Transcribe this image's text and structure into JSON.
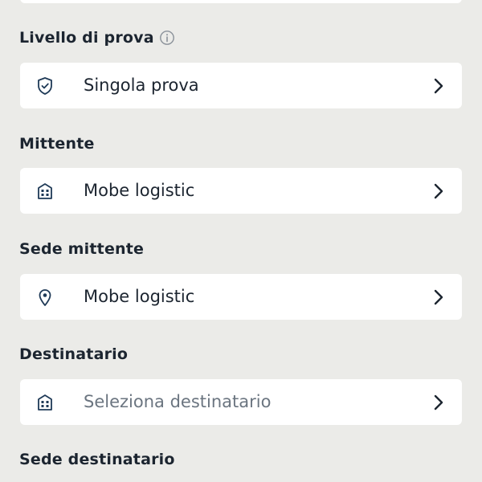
{
  "sections": [
    {
      "label": "Livello di prova",
      "value": "Singola prova",
      "icon": "shield-check-icon",
      "placeholder": false
    },
    {
      "label": "Mittente",
      "value": "Mobe logistic",
      "icon": "building-icon",
      "placeholder": false
    },
    {
      "label": "Sede mittente",
      "value": "Mobe logistic",
      "icon": "location-pin-icon",
      "placeholder": false
    },
    {
      "label": "Destinatario",
      "value": "Seleziona destinatario",
      "icon": "building-icon",
      "placeholder": true
    },
    {
      "label": "Sede destinatario"
    }
  ],
  "colors": {
    "background": "#ebebe8",
    "card": "#ffffff",
    "text": "#1c2530",
    "placeholder": "#6b7580",
    "icon": "#1f3a57"
  }
}
